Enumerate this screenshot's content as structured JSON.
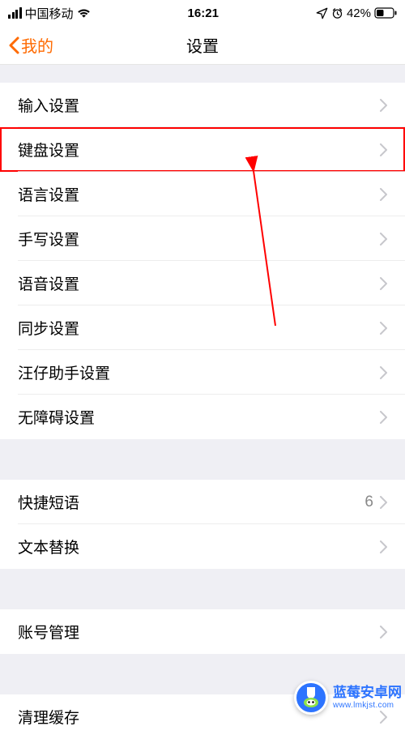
{
  "status": {
    "carrier": "中国移动",
    "time": "16:21",
    "battery_text": "42%"
  },
  "nav": {
    "back_label": "我的",
    "title": "设置"
  },
  "group1": {
    "input": "输入设置",
    "keyboard": "键盘设置",
    "language": "语言设置",
    "handwriting": "手写设置",
    "voice": "语音设置",
    "sync": "同步设置",
    "wangzai": "汪仔助手设置",
    "accessibility": "无障碍设置"
  },
  "group2": {
    "shortcuts": "快捷短语",
    "shortcuts_count": "6",
    "text_replace": "文本替换"
  },
  "group3": {
    "account": "账号管理"
  },
  "group4": {
    "clear_cache": "清理缓存"
  },
  "watermark": {
    "title": "蓝莓安卓网",
    "url": "www.lmkjst.com"
  }
}
